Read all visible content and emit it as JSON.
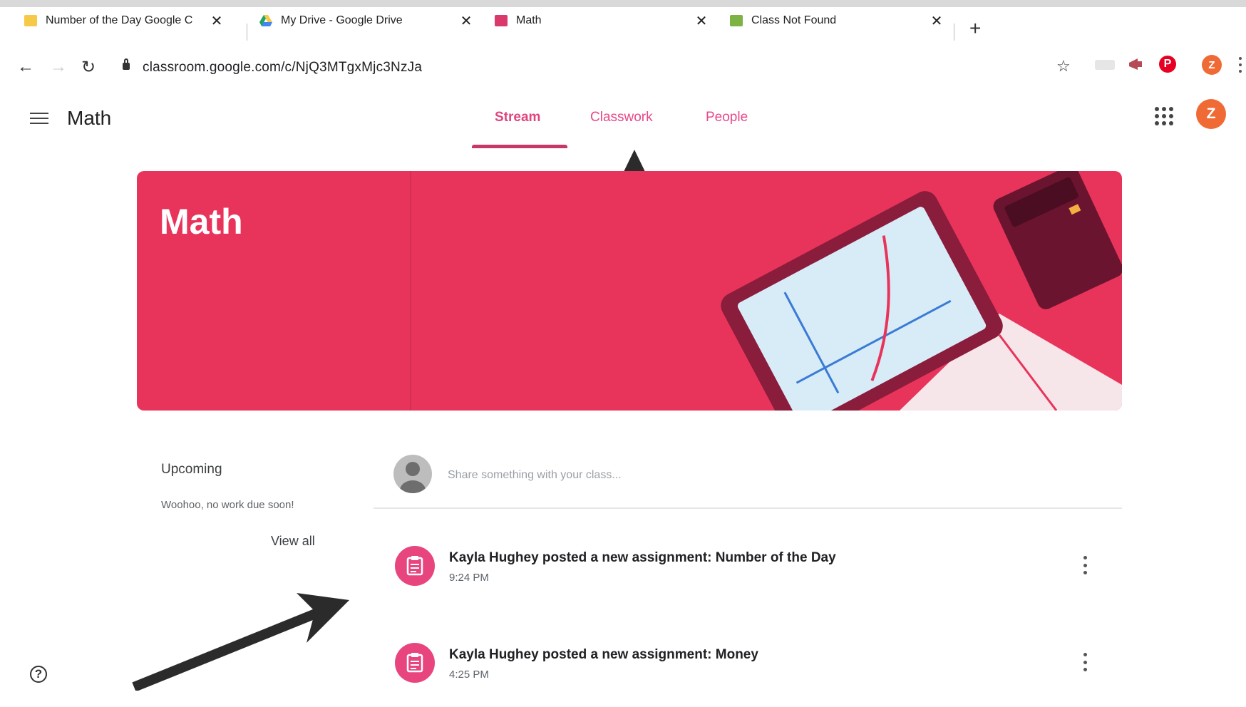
{
  "browser": {
    "tabs": [
      {
        "title": "Number of the Day Google C",
        "favicon": "classroom-yellow-icon"
      },
      {
        "title": "My Drive - Google Drive",
        "favicon": "google-drive-icon"
      },
      {
        "title": "Math",
        "favicon": "classroom-pink-icon"
      },
      {
        "title": "Class Not Found",
        "favicon": "classroom-green-icon"
      }
    ],
    "close_glyph": "✕",
    "new_tab_glyph": "+",
    "url": "classroom.google.com/c/NjQ3MTgxMjc3NzJa",
    "profile_initial": "Z"
  },
  "header": {
    "title": "Math",
    "tabs": [
      {
        "label": "Stream",
        "active": true
      },
      {
        "label": "Classwork",
        "active": false
      },
      {
        "label": "People",
        "active": false
      }
    ],
    "avatar_initial": "Z"
  },
  "banner": {
    "title": "Math",
    "color": "#e8345a"
  },
  "upcoming": {
    "title": "Upcoming",
    "note": "Woohoo, no work due soon!",
    "view_all": "View all"
  },
  "share": {
    "placeholder": "Share something with your class..."
  },
  "posts": [
    {
      "text": "Kayla Hughey posted a new assignment: Number of the Day",
      "time": "9:24 PM"
    },
    {
      "text": "Kayla Hughey posted a new assignment: Money",
      "time": "4:25 PM"
    }
  ],
  "colors": {
    "accent": "#e0457e",
    "avatar": "#f06a35"
  }
}
